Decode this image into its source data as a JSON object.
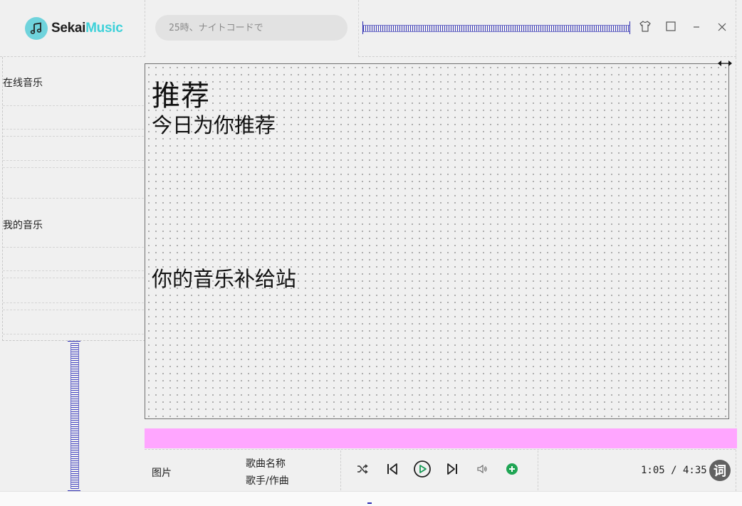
{
  "app": {
    "logo_part1": "Sekai",
    "logo_part2": "Music",
    "brand_color": "#3ed1d9"
  },
  "search": {
    "placeholder": "25時、ナイトコードで"
  },
  "window_controls": [
    "skin-icon",
    "maximize-icon",
    "minimize-icon",
    "close-icon"
  ],
  "sidebar": {
    "sections": [
      {
        "title": "在线音乐"
      },
      {
        "title": "我的音乐"
      }
    ]
  },
  "main": {
    "title": "推荐",
    "sections": [
      "今日为你推荐",
      "你的音乐补给站"
    ]
  },
  "player": {
    "cover_label": "图片",
    "song_name": "歌曲名称",
    "artist": "歌手/作曲",
    "controls": [
      "shuffle-icon",
      "previous-icon",
      "play-icon",
      "next-icon",
      "volume-icon",
      "add-icon"
    ],
    "current_time": "1:05",
    "total_time": "4:35",
    "time_display": "1:05 / 4:35",
    "lyrics_label": "词",
    "accent_play": "#1a9a57",
    "accent_add": "#1fa554",
    "progress_color": "#ffa6ff"
  }
}
